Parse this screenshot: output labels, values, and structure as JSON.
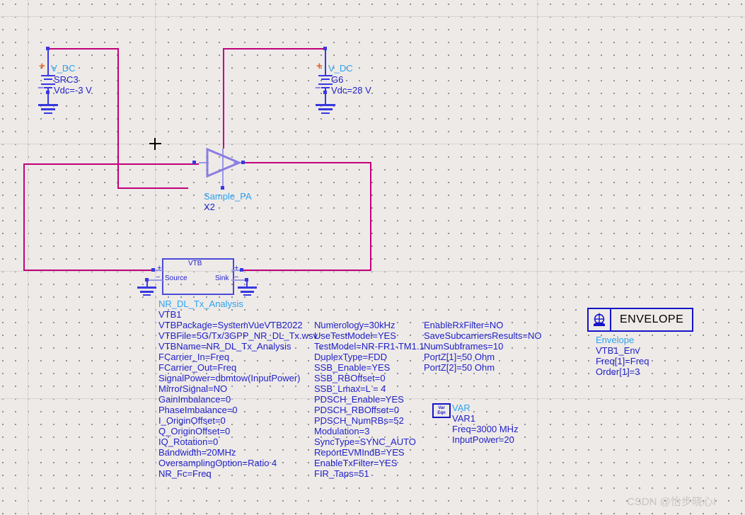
{
  "app": {
    "canvas_name": "schematic-canvas",
    "background_color": "#eeeae8",
    "wire_color": "#c2007b",
    "device_color": "#3838e0",
    "label_color": "#2222c8",
    "name_color": "#2aa3f0"
  },
  "components": {
    "src3": {
      "type": "V_DC",
      "type_label": "V_DC",
      "instance": "SRC3",
      "param": "Vdc=-3 V",
      "plus": "+",
      "minus": "−"
    },
    "g6": {
      "type": "V_DC",
      "type_label": "V_DC",
      "instance": "G6",
      "param": "Vdc=28 V",
      "plus": "+",
      "minus": "−"
    },
    "amplifier": {
      "type_label": "Sample_PA",
      "instance": "X2"
    },
    "vtb": {
      "box_title": "VTB",
      "port_source": "Source",
      "port_sink": "Sink",
      "plus": "+",
      "minus": "−",
      "type_label": "NR_DL_Tx_Analysis",
      "instance": "VTB1",
      "params_col1": [
        "VTBPackage=SystemVueVTB2022",
        "VTBFile=5G/Tx/3GPP_NR_DL_Tx.wsv",
        "VTBName=NR_DL_Tx_Analysis",
        "FCarrier_In=Freq",
        "FCarrier_Out=Freq",
        "SignalPower=dbmtow(InputPower)",
        "MirrorSignal=NO",
        "GainImbalance=0",
        "PhaseImbalance=0",
        "I_OriginOffset=0",
        "Q_OriginOffset=0",
        "IQ_Rotation=0",
        "Bandwidth=20MHz",
        "OversamplingOption=Ratio 4",
        "NR_Fc=Freq"
      ],
      "params_col2": [
        "Numerology=30kHz",
        "UseTestModel=YES",
        "TestModel=NR-FR1-TM1.1",
        "DuplexType=FDD",
        "SSB_Enable=YES",
        "SSB_RBOffset=0",
        "SSB_Lmax=L = 4",
        "PDSCH_Enable=YES",
        "PDSCH_RBOffset=0",
        "PDSCH_NumRBs=52",
        "Modulation=3",
        "SyncType=SYNC_AUTO",
        "ReportEVMIndB=YES",
        "EnableTxFilter=YES",
        "FIR_Taps=51"
      ],
      "params_col3": [
        "EnableRxFilter=NO",
        "SaveSubcarriersResults=NO",
        "NumSubframes=10",
        "PortZ[1]=50 Ohm",
        "PortZ[2]=50 Ohm"
      ]
    },
    "var": {
      "icon_line1": "Var",
      "icon_line2": "Eqn",
      "type_label": "VAR",
      "instance": "VAR1",
      "params": [
        "Freq=3000 MHz",
        "InputPower=20"
      ]
    },
    "envelope": {
      "block_text": "ENVELOPE",
      "type_label": "Envelope",
      "instance": "VTB1_Env",
      "params": [
        "Freq[1]=Freq",
        "Order[1]=3"
      ]
    }
  },
  "watermark": {
    "text": "CSDN @怡步晓心I"
  }
}
